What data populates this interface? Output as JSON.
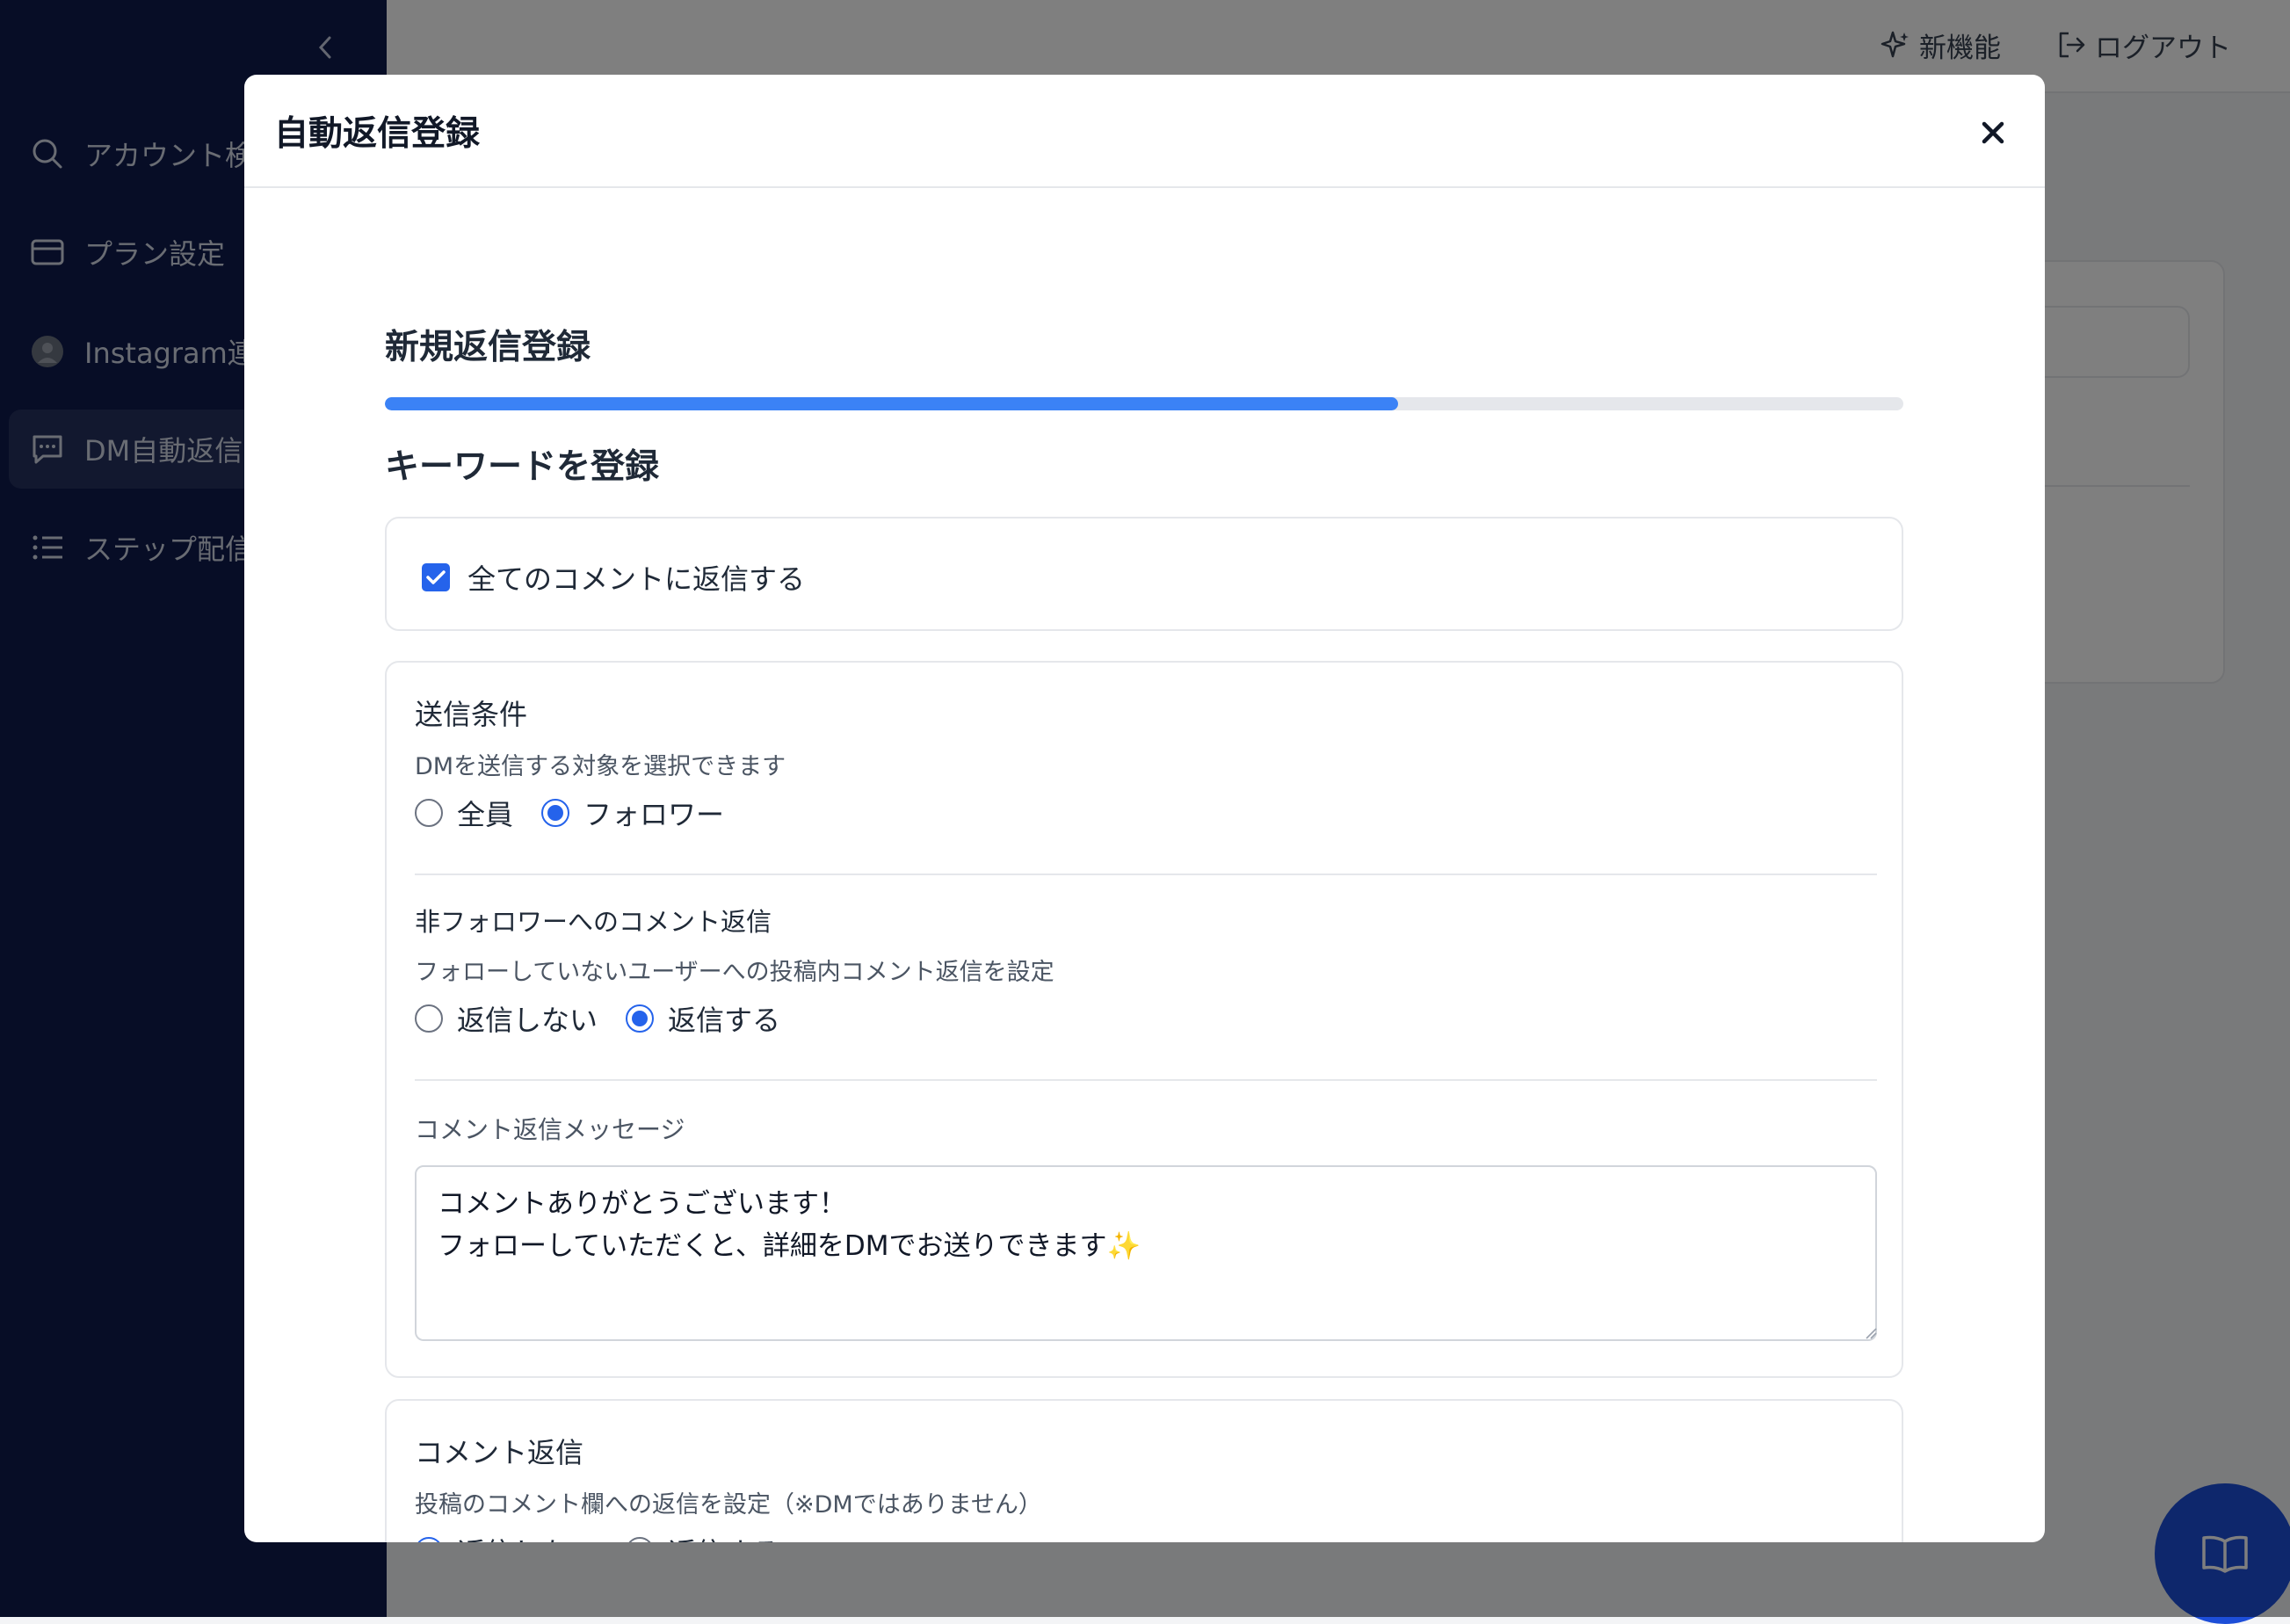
{
  "sidebar": {
    "collapse_icon": "chevron-left-icon",
    "items": [
      {
        "label": "アカウント検索",
        "icon": "search-icon"
      },
      {
        "label": "プラン設定",
        "icon": "credit-card-icon"
      },
      {
        "label": "Instagram連携",
        "icon": "avatar-icon"
      },
      {
        "label": "DM自動返信",
        "icon": "chat-icon",
        "active": true
      },
      {
        "label": "ステップ配信",
        "icon": "list-icon"
      }
    ]
  },
  "topbar": {
    "new_features": "新機能",
    "logout": "ログアウト"
  },
  "modal": {
    "title": "自動返信登録",
    "section_title": "新規返信登録",
    "progress": 0.667,
    "step_title": "キーワードを登録",
    "all_comments": {
      "label": "全てのコメントに返信する",
      "checked": true
    },
    "send_condition": {
      "title": "送信条件",
      "description": "DMを送信する対象を選択できます",
      "options": [
        "全員",
        "フォロワー"
      ],
      "selected": "フォロワー"
    },
    "non_follower_reply": {
      "title": "非フォロワーへのコメント返信",
      "description": "フォローしていないユーザーへの投稿内コメント返信を設定",
      "options": [
        "返信しない",
        "返信する"
      ],
      "selected": "返信する"
    },
    "comment_reply_message": {
      "label": "コメント返信メッセージ",
      "value": "コメントありがとうございます！\nフォローしていただくと、詳細をDMでお送りできます✨"
    },
    "comment_reply": {
      "title": "コメント返信",
      "description": "投稿のコメント欄への返信を設定（※DMではありません）",
      "options": [
        "返信しない",
        "返信する"
      ],
      "selected": "返信しない"
    }
  },
  "colors": {
    "sidebar_bg": "#0f1b4d",
    "accent": "#2563eb",
    "progress": "#3b82f6"
  }
}
